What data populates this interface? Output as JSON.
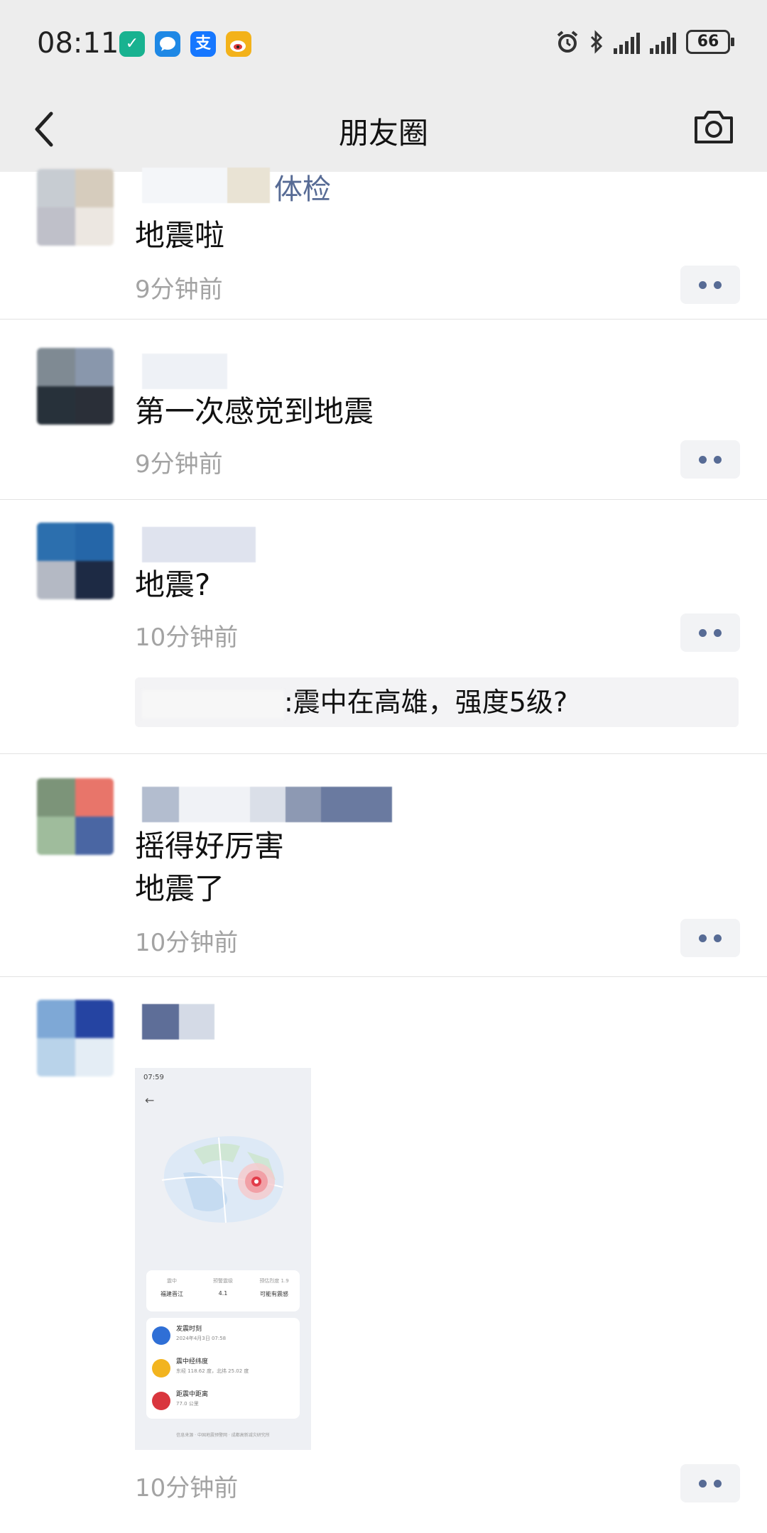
{
  "status_bar": {
    "time": "08:11",
    "app_icons": [
      {
        "name": "mijia-icon",
        "glyph": "✓",
        "color": "#18b290"
      },
      {
        "name": "message-icon",
        "glyph": "💬",
        "color": "#1e88e5"
      },
      {
        "name": "alipay-icon",
        "glyph": "支",
        "color": "#1677ff"
      },
      {
        "name": "weibo-icon",
        "glyph": "◉",
        "color": "#f3b21a"
      }
    ],
    "battery": "66"
  },
  "header": {
    "title": "朋友圈"
  },
  "posts": [
    {
      "nickname": "体检",
      "content": [
        "地震啦"
      ],
      "time": "9分钟前"
    },
    {
      "nickname": "",
      "content": [
        "第一次感觉到地震"
      ],
      "time": "9分钟前"
    },
    {
      "nickname": "",
      "content": [
        "地震?"
      ],
      "time": "10分钟前",
      "comment": ":震中在高雄，强度5级?"
    },
    {
      "nickname": "",
      "content": [
        "摇得好厉害",
        "地震了"
      ],
      "time": "10分钟前"
    },
    {
      "nickname": "",
      "content": [],
      "time": "10分钟前"
    }
  ],
  "thumbnail": {
    "status_time": "07:59",
    "stats": [
      {
        "label": "震中",
        "value": "福建晋江"
      },
      {
        "label": "预警震级",
        "value": "4.1"
      },
      {
        "label": "预估烈度 1.9",
        "value": "可能有震感"
      }
    ],
    "items": [
      {
        "title": "发震时刻",
        "sub": "2024年4月3日 07:58",
        "color": "#2f6fd6"
      },
      {
        "title": "震中经纬度",
        "sub": "东经 118.62 度，北纬 25.02 度",
        "color": "#f2b41f"
      },
      {
        "title": "距震中距离",
        "sub": "77.0 公里",
        "color": "#d9363e"
      }
    ],
    "footer": "信息来源 · 中国地震预警网 · 成都高新减灾研究所"
  },
  "colors": {
    "nickname": "#576b95",
    "time": "#a3a3a3",
    "topbar_bg": "#ededed"
  }
}
